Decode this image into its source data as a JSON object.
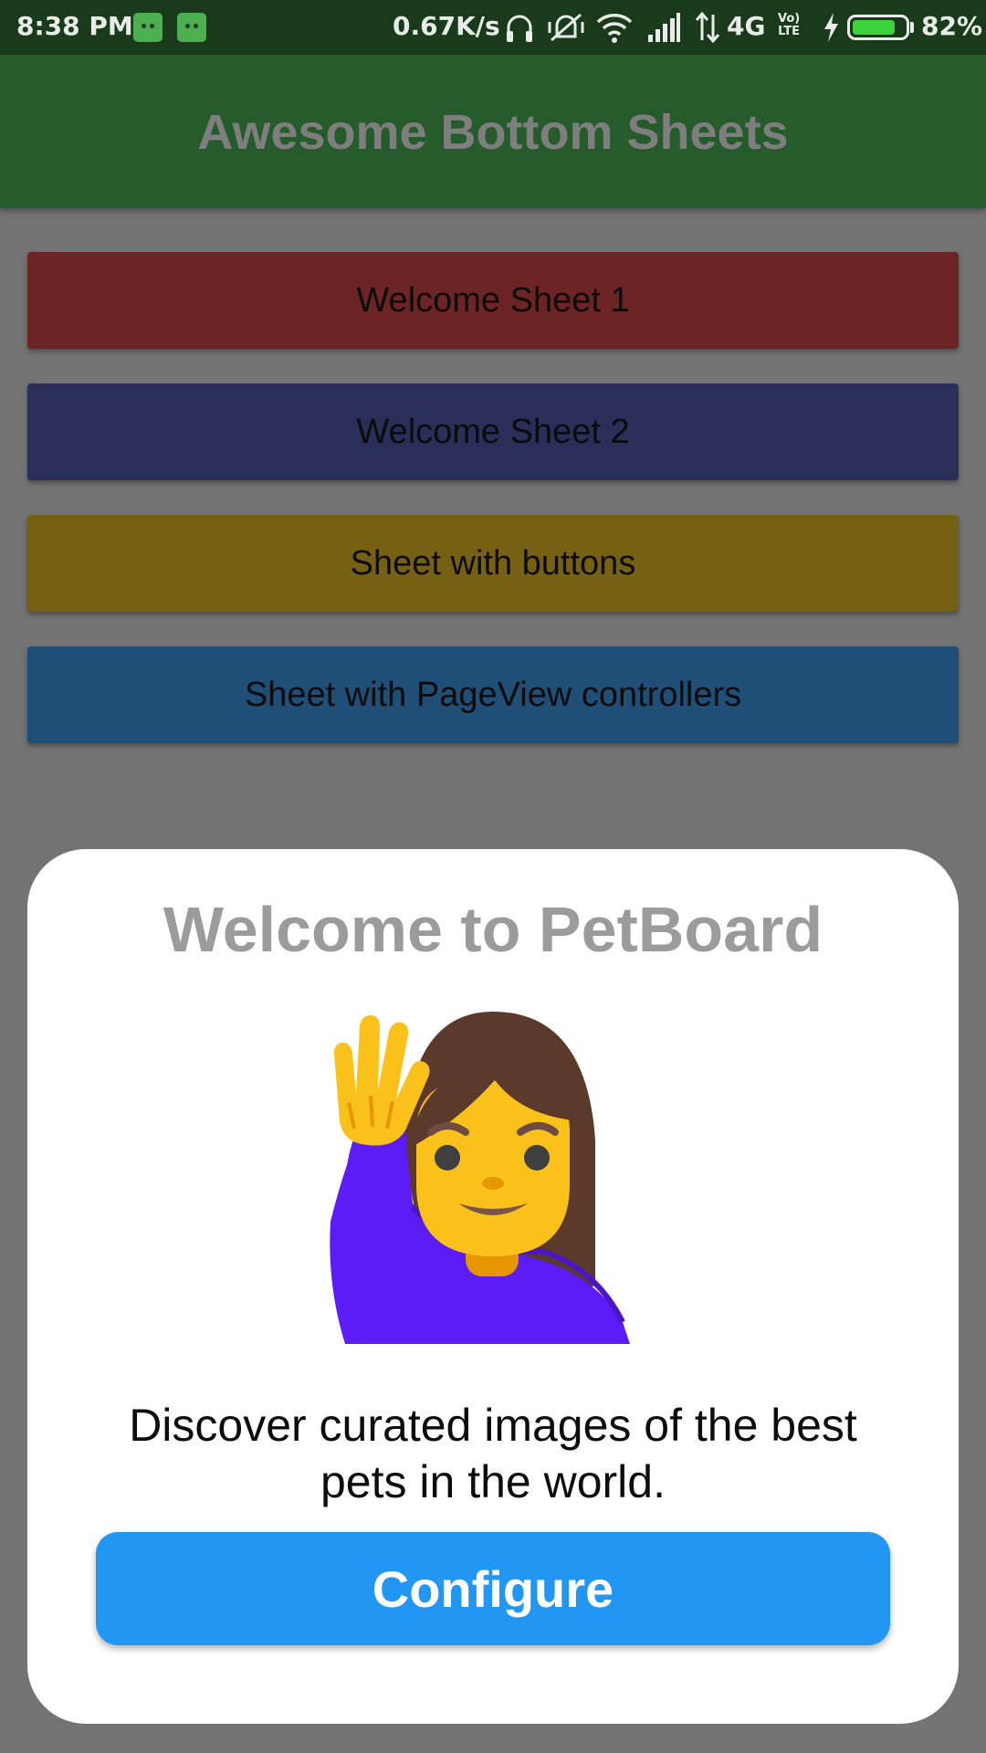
{
  "status_bar": {
    "time": "8:38 PM",
    "net_speed": "0.67K/s",
    "network": "4G",
    "volte_line1": "Vo)",
    "volte_line2": "LTE",
    "battery_pct": "82%",
    "battery_level": 0.82,
    "icons": [
      "app-icon",
      "app-icon",
      "headphones-icon",
      "vibrate-off-icon",
      "wifi-icon",
      "signal-icon",
      "data-arrows-icon",
      "volte-icon",
      "charging-icon",
      "battery-icon"
    ]
  },
  "app_bar": {
    "title": "Awesome Bottom Sheets"
  },
  "buttons": [
    {
      "label": "Welcome Sheet 1",
      "color": "#6d2424"
    },
    {
      "label": "Welcome Sheet 2",
      "color": "#292f59"
    },
    {
      "label": "Sheet with buttons",
      "color": "#766013"
    },
    {
      "label": "Sheet with PageView controllers",
      "color": "#1f4e76"
    }
  ],
  "sheet": {
    "title": "Welcome to PetBoard",
    "image": "woman-raising-hand-emoji",
    "description": "Discover curated images of the best pets in the world.",
    "button_label": "Configure",
    "button_color": "#2196f3"
  }
}
